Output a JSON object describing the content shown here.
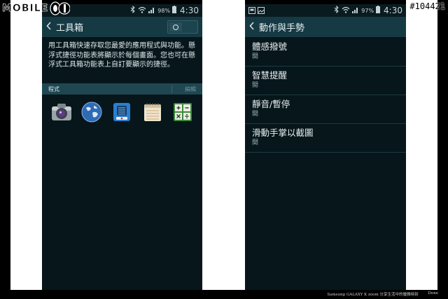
{
  "watermark": {
    "brand": "MOBILE",
    "id": "#104421"
  },
  "left_screen": {
    "status": {
      "battery": "98%",
      "time": "4:30"
    },
    "title": "工具箱",
    "description": "用工具箱快速存取您最愛的應用程式與功能。懸浮式捷徑功能表將顯示於每個畫面。您也可在懸浮式工具箱功能表上自訂要顯示的捷徑。",
    "section": {
      "label": "程式",
      "edit": "編輯"
    },
    "apps": [
      "camera-icon",
      "internet-globe-icon",
      "voice-recorder-icon",
      "memo-icon",
      "calculator-icon"
    ]
  },
  "right_screen": {
    "status": {
      "battery": "97%",
      "time": "4:30"
    },
    "title": "動作與手勢",
    "items": [
      {
        "label": "體感撥號",
        "value": "開"
      },
      {
        "label": "智慧提醒",
        "value": "開"
      },
      {
        "label": "靜音/暫停",
        "value": "開"
      },
      {
        "label": "滑動手掌以截圖",
        "value": "開"
      }
    ]
  },
  "caption": {
    "text": "Samsung GALAXY K zoom 分享生活中的優雅時刻",
    "right": "Done"
  },
  "colors": {
    "screen_bg": "#06161b",
    "action_bar": "#163a44",
    "section_bar": "#1e4752"
  }
}
